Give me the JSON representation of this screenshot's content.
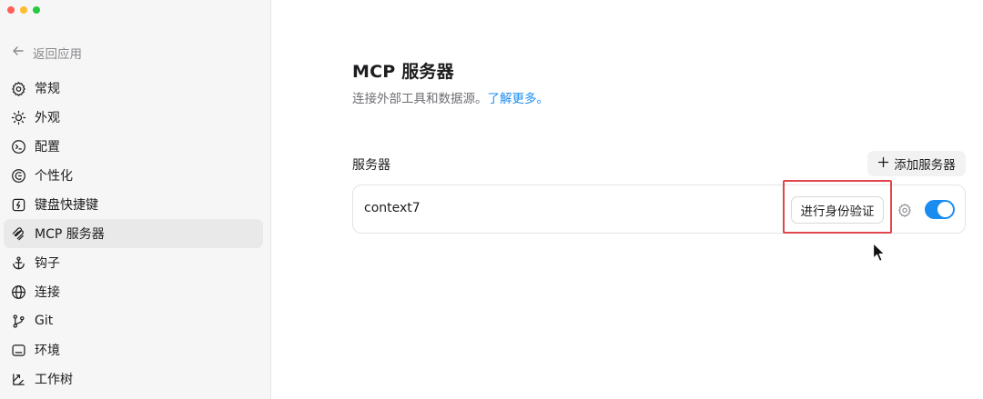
{
  "sidebar": {
    "back_label": "返回应用",
    "items": [
      {
        "label": "常规",
        "icon": "gear-icon"
      },
      {
        "label": "外观",
        "icon": "sun-icon"
      },
      {
        "label": "配置",
        "icon": "terminal-icon"
      },
      {
        "label": "个性化",
        "icon": "personalize-icon"
      },
      {
        "label": "键盘快捷键",
        "icon": "keyboard-icon"
      },
      {
        "label": "MCP 服务器",
        "icon": "mcp-icon",
        "active": true
      },
      {
        "label": "钩子",
        "icon": "anchor-icon"
      },
      {
        "label": "连接",
        "icon": "globe-icon"
      },
      {
        "label": "Git",
        "icon": "git-branch-icon"
      },
      {
        "label": "环境",
        "icon": "environment-icon"
      },
      {
        "label": "工作树",
        "icon": "worktree-icon"
      }
    ]
  },
  "main": {
    "title": "MCP 服务器",
    "subtitle": "连接外部工具和数据源。",
    "learn_more": "了解更多。",
    "section_label": "服务器",
    "add_button": "添加服务器",
    "servers": [
      {
        "name": "context7",
        "auth_button": "进行身份验证",
        "enabled": true
      }
    ]
  },
  "colors": {
    "accent": "#1a8cf0",
    "highlight": "#e0464b",
    "sidebar_bg": "#f6f6f6",
    "active_item_bg": "#e9e9e9"
  }
}
